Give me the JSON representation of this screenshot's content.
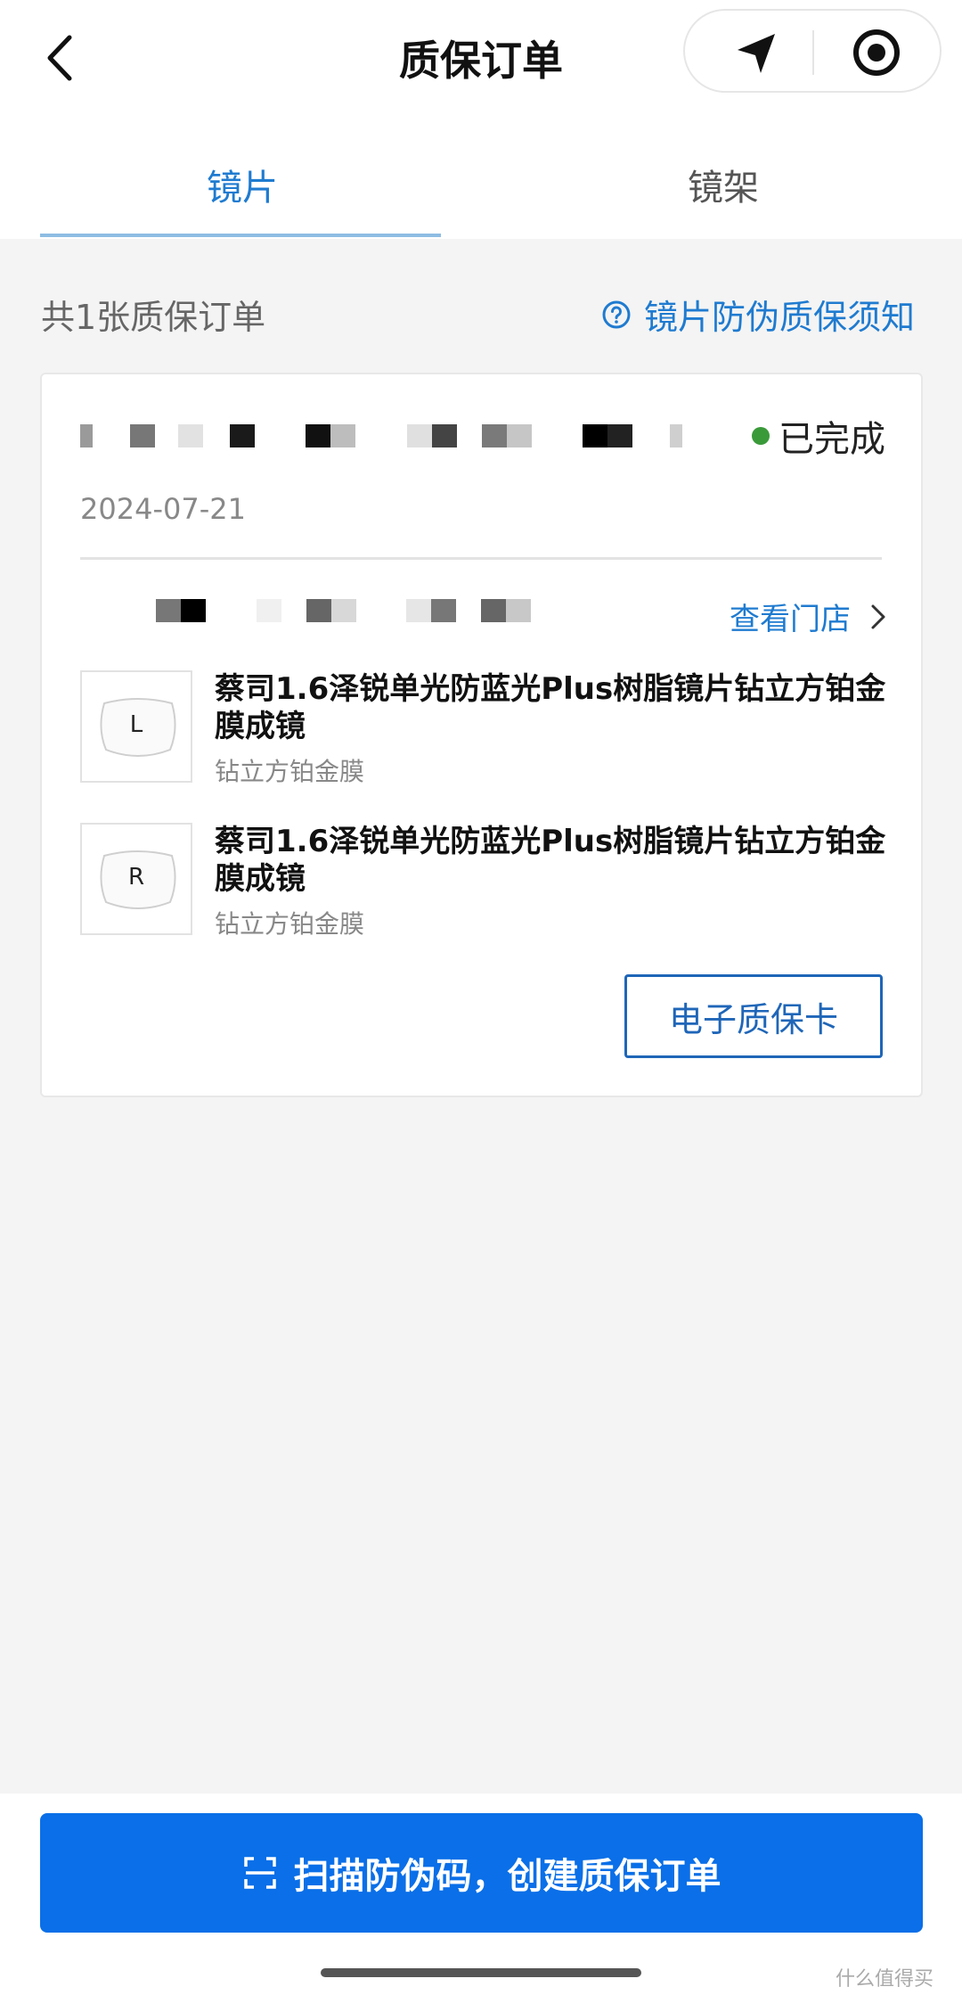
{
  "header": {
    "title": "质保订单",
    "back_icon": "chevron-left-icon",
    "nav_icon": "navigation-arrow-icon",
    "target_icon": "record-target-icon"
  },
  "tabs": [
    {
      "label": "镜片",
      "active": true
    },
    {
      "label": "镜架",
      "active": false
    }
  ],
  "summary": {
    "count_text": "共1张质保订单",
    "notice_label": "镜片防伪质保须知",
    "notice_icon": "question-circle-icon"
  },
  "order": {
    "status": "已完成",
    "status_color": "#3a9a3a",
    "date": "2024-07-21",
    "store_link_label": "查看门店",
    "items": [
      {
        "thumb_label": "L",
        "name": "蔡司1.6泽锐单光防蓝光Plus树脂镜片钻立方铂金膜成镜",
        "sub": "钻立方铂金膜"
      },
      {
        "thumb_label": "R",
        "name": "蔡司1.6泽锐单光防蓝光Plus树脂镜片钻立方铂金膜成镜",
        "sub": "钻立方铂金膜"
      }
    ],
    "ecard_button": "电子质保卡"
  },
  "bottom": {
    "scan_button": "扫描防伪码，创建质保订单",
    "scan_icon": "scan-frame-icon",
    "watermark": "什么值得买"
  },
  "colors": {
    "accent": "#1f7bd0",
    "primary_button": "#0a6fe8"
  }
}
